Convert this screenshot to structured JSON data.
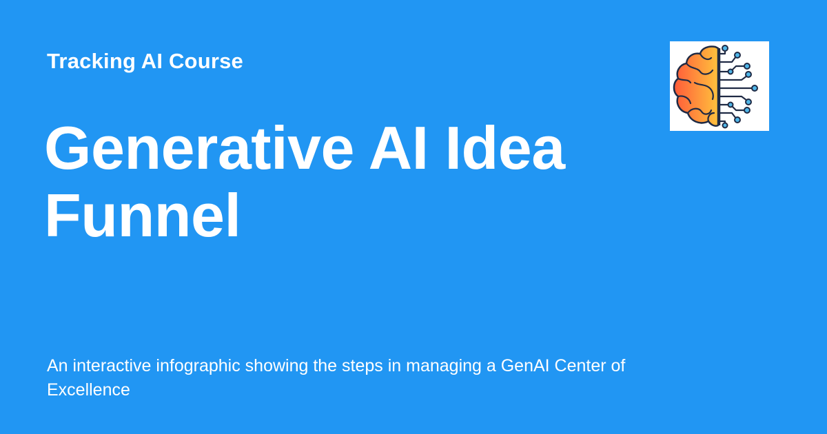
{
  "site": {
    "name": "Tracking AI Course"
  },
  "page": {
    "title": "Generative AI Idea Funnel",
    "description": "An interactive infographic showing the steps in managing a GenAI Center of Excellence",
    "background_color": "#2196f3",
    "text_color": "#ffffff"
  },
  "logo": {
    "icon": "brain-circuit-icon",
    "colors": {
      "brain_gradient_start": "#ff5b3a",
      "brain_gradient_end": "#ffc23d",
      "circuit_node": "#4fb6e8",
      "outline": "#1f2a44"
    }
  }
}
